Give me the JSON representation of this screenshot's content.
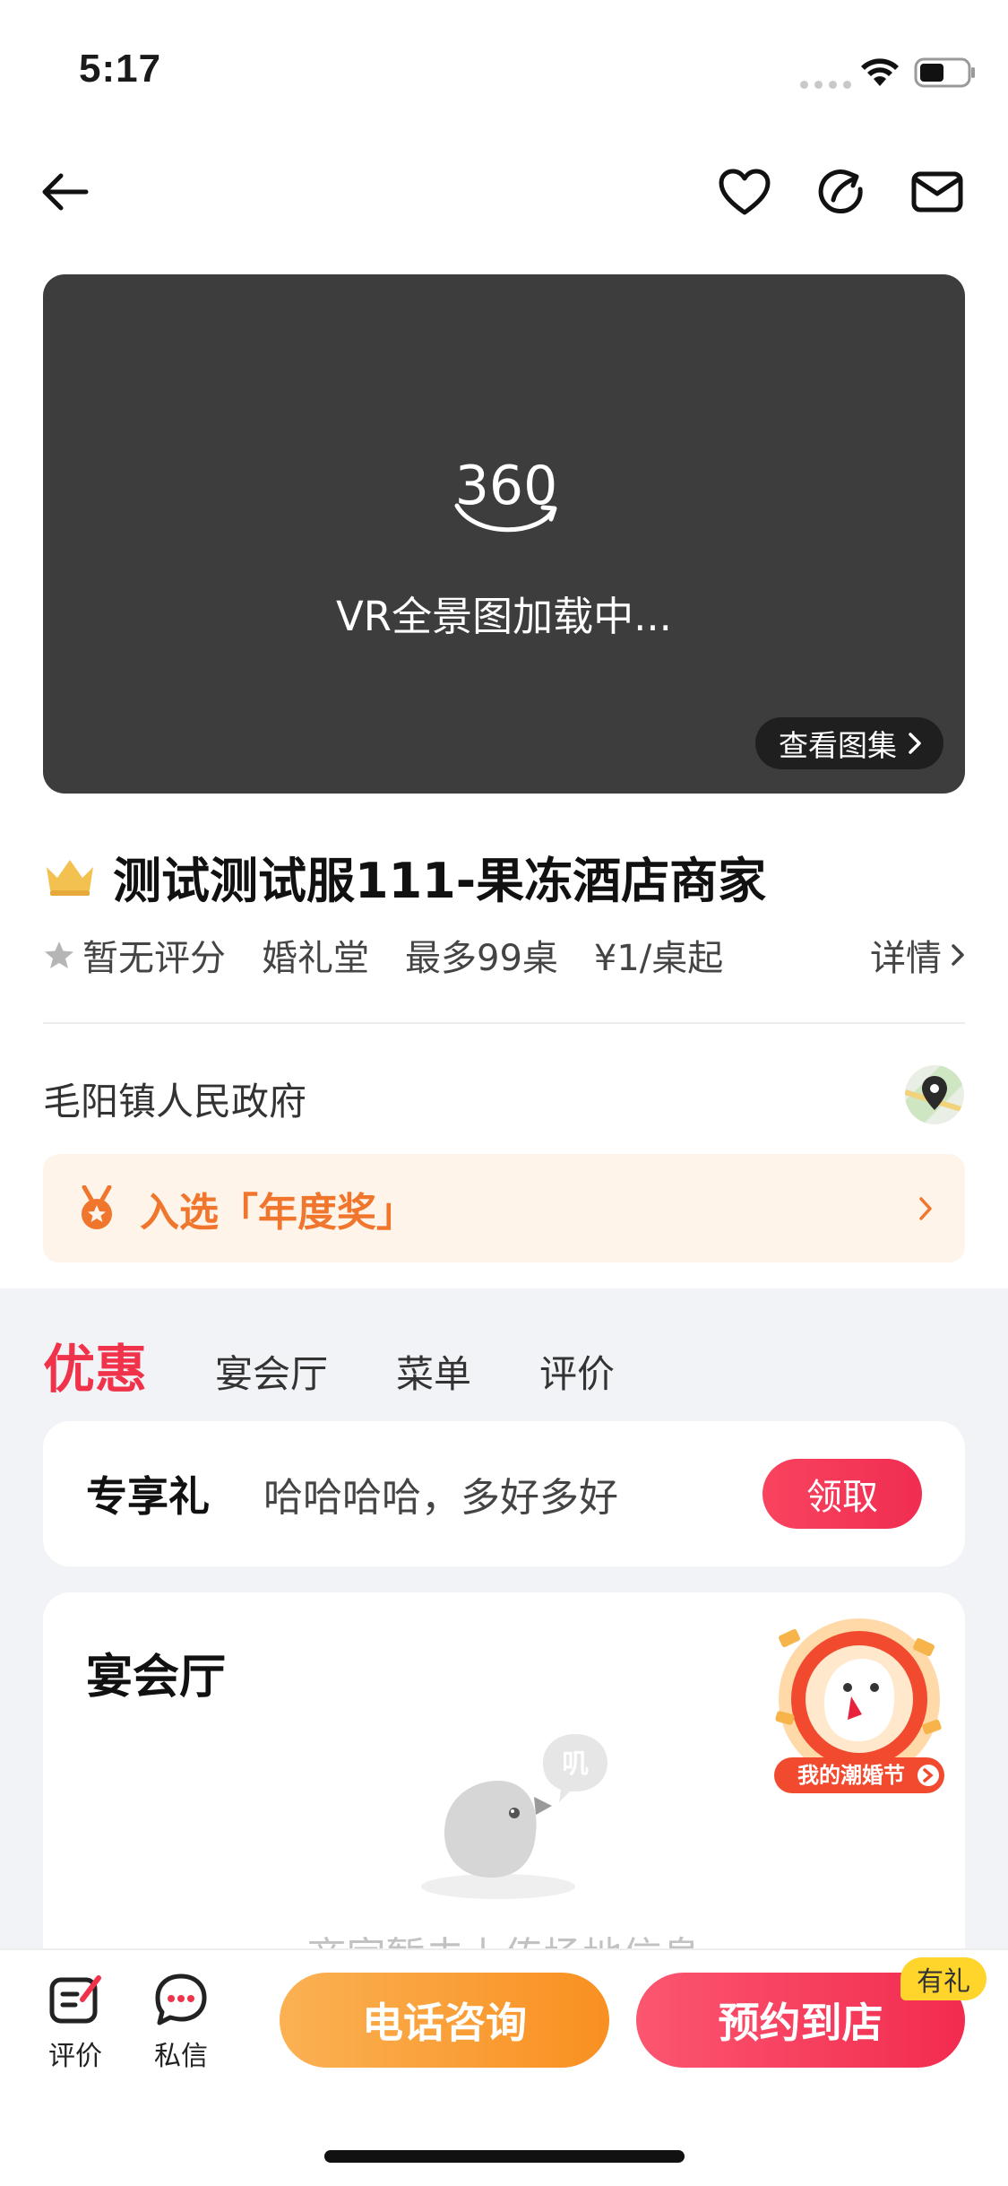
{
  "status_bar": {
    "time": "5:17"
  },
  "vr": {
    "loading_text": "VR全景图加载中...",
    "gallery_label": "查看图集"
  },
  "merchant": {
    "name": "测试测试服111-果冻酒店商家",
    "rating": "暂无评分",
    "type": "婚礼堂",
    "tables": "最多99桌",
    "price": "¥1/桌起",
    "detail_label": "详情",
    "address": "毛阳镇人民政府",
    "award_text": "入选「年度奖」"
  },
  "tabs": [
    {
      "label": "优惠",
      "active": true
    },
    {
      "label": "宴会厅",
      "active": false
    },
    {
      "label": "菜单",
      "active": false
    },
    {
      "label": "评价",
      "active": false
    }
  ],
  "gift": {
    "title": "专享礼",
    "desc": "哈哈哈哈，多好多好",
    "button": "领取"
  },
  "hall": {
    "title": "宴会厅",
    "empty_text": "商家暂未上传场地信息",
    "bubble_text": "叽"
  },
  "promo": {
    "label": "我的潮婚节"
  },
  "bottom_bar": {
    "review_label": "评价",
    "message_label": "私信",
    "phone_button": "电话咨询",
    "book_button": "预约到店",
    "gift_tag": "有礼"
  },
  "colors": {
    "accent_red": "#f0334a",
    "award_orange": "#f0762d",
    "phone_orange": "#f99021",
    "vr_background": "#3d3d3d"
  },
  "icons": [
    "back-arrow-icon",
    "heart-icon",
    "share-icon",
    "mail-icon",
    "star-icon",
    "crown-icon",
    "map-pin-icon",
    "medal-icon",
    "chevron-right-icon",
    "review-icon",
    "chat-icon"
  ]
}
